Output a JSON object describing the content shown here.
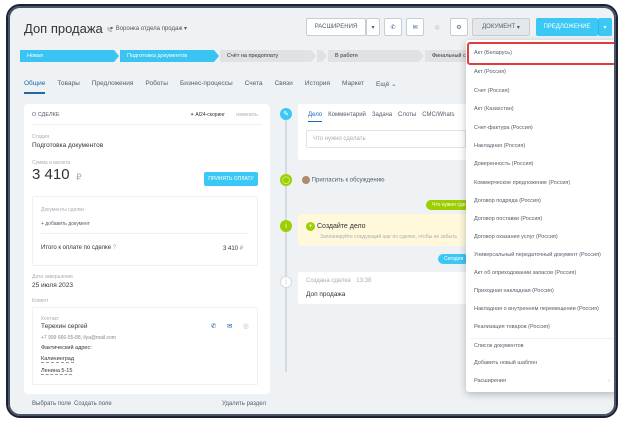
{
  "header": {
    "title": "Доп продажа",
    "funnel": "Воронка отдела продаж",
    "btn_ext": "РАСШИРЕНИЯ",
    "btn_doc": "ДОКУМЕНТ",
    "btn_offer": "ПРЕДЛОЖЕНИЕ"
  },
  "stages": [
    {
      "label": "Новая",
      "color": "#39c4f3"
    },
    {
      "label": "Подготовка документов",
      "color": "#39c4f3"
    },
    {
      "label": "Счёт на предоплату",
      "color": "#dfe3e6"
    },
    {
      "label": "",
      "color": "#dfe3e6"
    },
    {
      "label": "В работе",
      "color": "#dfe3e6"
    },
    {
      "label": "Финальный счёт",
      "color": "#dfe3e6"
    }
  ],
  "tabs": [
    "Общие",
    "Товары",
    "Предложения",
    "Роботы",
    "Бизнес-процессы",
    "Счета",
    "Связи",
    "История",
    "Маркет",
    "Ещё"
  ],
  "deal": {
    "section": "О СДЕЛКЕ",
    "ai_label": "AI24-скоринг",
    "edit": "изменить",
    "stage_label": "Стадия",
    "stage_value": "Подготовка документов",
    "sum_label": "Сумма и валюта",
    "sum_value": "3 410",
    "currency": "₽",
    "pay_btn": "ПРИНЯТЬ ОПЛАТУ",
    "docs_label": "Документы сделки",
    "add_doc": "+ добавить документ",
    "total_label": "Итого к оплате по сделке",
    "total_value": "3 410",
    "date_label": "Дата завершения",
    "date_value": "25 июля 2023",
    "client_label": "Клиент",
    "contact_label": "Контакт",
    "contact_name": "Терехин сергей",
    "contact_info": "+7 999 666-55-88, ilya@mail.com",
    "address_label": "Фактический адрес:",
    "city": "Калининград",
    "street": "Ленина 5-15",
    "choose_field": "Выбрать поле",
    "create_field": "Создать поле",
    "delete_section": "Удалить раздел"
  },
  "timeline": {
    "tabs": [
      "Дело",
      "Комментарий",
      "Задача",
      "Слоты",
      "СМС/Whats"
    ],
    "placeholder": "Что нужно сделать",
    "invite": "Пригласить к обсуждению",
    "todo_badge": "Что нужно сде",
    "create_task": "Создайте дело",
    "create_hint": "Запланируйте следующий шаг по сделке, чтобы не забыть",
    "today_badge": "Сегодня",
    "created_label": "Создана сделка",
    "created_time": "13:38",
    "created_value": "Доп продажа"
  },
  "menu": {
    "items": [
      "Акт (Беларусь)",
      "Акт (Россия)",
      "Счет (Россия)",
      "Акт (Казахстан)",
      "Счет-фактура (Россия)",
      "Накладная (Россия)",
      "Доверенность (Россия)",
      "Коммерческое предложение (Россия)",
      "Договор подряда (Россия)",
      "Договор поставки (Россия)",
      "Договор оказания услуг (Россия)",
      "Универсальный передаточный документ (Россия)",
      "Акт об оприходовании запасов (Россия)",
      "Приходная накладная (Россия)",
      "Накладная о внутреннем перемещении (Россия)",
      "Реализация товаров (Россия)",
      "Список документов",
      "Добавить новый шаблон",
      "Расширения"
    ]
  },
  "colors": {
    "accent": "#3bc8f5",
    "link": "#2067b0",
    "highlight": "#e03c3c",
    "green": "#9dcf00"
  }
}
